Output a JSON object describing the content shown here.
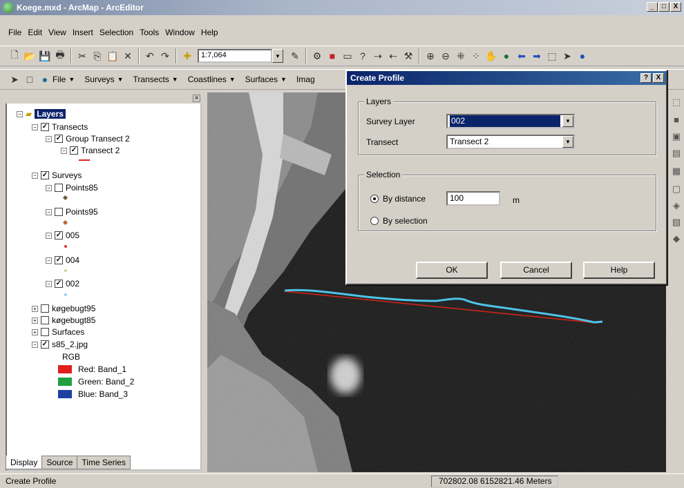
{
  "window": {
    "title": "Koege.mxd - ArcMap - ArcEditor",
    "minimize": "_",
    "maximize": "□",
    "close": "X"
  },
  "menu": [
    "File",
    "Edit",
    "View",
    "Insert",
    "Selection",
    "Tools",
    "Window",
    "Help"
  ],
  "toolbar1": {
    "scale": "1:7,064"
  },
  "toolbar2": {
    "menus": [
      "File",
      "Surveys",
      "Transects",
      "Coastlines",
      "Surfaces",
      "Imag"
    ]
  },
  "toc": {
    "root": "Layers",
    "items": {
      "transects": "Transects",
      "group_transect": "Group Transect 2",
      "transect2": "Transect 2",
      "surveys": "Surveys",
      "points85": "Points85",
      "points95": "Points95",
      "s005": "005",
      "s004": "004",
      "s002": "002",
      "kogebugt95": "køgebugt95",
      "kogebugt85": "køgebugt85",
      "surfaces": "Surfaces",
      "s85jpg": "s85_2.jpg",
      "rgb": "RGB",
      "red": "Red:   Band_1",
      "green": "Green: Band_2",
      "blue": "Blue:   Band_3"
    },
    "colors": {
      "transect_line": "#d9241b",
      "points85": "#6b5a3a",
      "points95": "#b8662a",
      "s005": "#e0303a",
      "s004": "#c8d890",
      "s002": "#8fd0f0",
      "red_band": "#e02020",
      "green_band": "#20a040",
      "blue_band": "#2040a0"
    }
  },
  "tabs": [
    "Display",
    "Source",
    "Time Series"
  ],
  "status": {
    "text": "Create Profile",
    "coords": "702802.08  6152821.46 Meters"
  },
  "dialog": {
    "title": "Create Profile",
    "help_btn": "?",
    "close_btn": "X",
    "layers_group": "Layers",
    "survey_layer_label": "Survey Layer",
    "survey_layer_value": "002",
    "transect_label": "Transect",
    "transect_value": "Transect 2",
    "selection_group": "Selection",
    "by_distance": "By distance",
    "distance_value": "100",
    "unit": "m",
    "by_selection": "By selection",
    "ok": "OK",
    "cancel": "Cancel",
    "help": "Help"
  }
}
